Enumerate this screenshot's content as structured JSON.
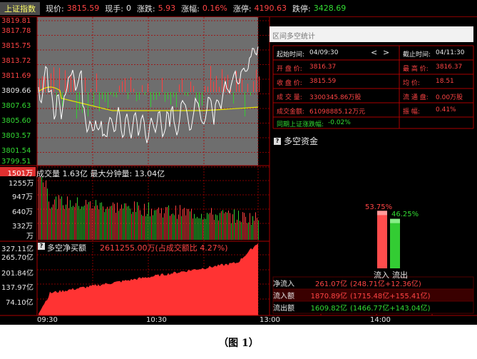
{
  "header": {
    "title": "上证指数",
    "price_label": "现价:",
    "price": "3815.59",
    "vol_label": "现手:",
    "vol": "0",
    "chg_label": "涨跌:",
    "chg": "5.93",
    "pct_label": "涨幅:",
    "pct": "0.16%",
    "high_label": "涨停:",
    "high": "4190.63",
    "low_label": "跌停:",
    "low": "3428.69"
  },
  "price_axis": {
    "labels": [
      "3819.81",
      "3817.78",
      "3815.75",
      "3813.72",
      "3811.69",
      "3809.66",
      "3807.63",
      "3805.60",
      "3803.57",
      "3801.54",
      "3799.51"
    ]
  },
  "volume_section": {
    "current_tag": "1501万",
    "title": "成交量 1.63亿  最大分钟量: 13.04亿",
    "axis_labels": [
      "1255万",
      "947万",
      "640万",
      "332万",
      "万"
    ]
  },
  "net_section": {
    "top_label": "327.11亿",
    "title": "多空净买额",
    "value": "2611255.00万(占成交额比 4.27%)",
    "axis_labels": [
      "265.70亿",
      "201.84亿",
      "137.97亿",
      "74.10亿"
    ]
  },
  "time_axis": {
    "labels": [
      "09:30",
      "10:30",
      "13:00",
      "14:00"
    ]
  },
  "stats_panel": {
    "title": "区间多空统计",
    "start_label": "起始时间:",
    "start": "04/09:30",
    "end_label": "截止时间:",
    "end": "04/11:30",
    "nav_prev": "<",
    "nav_next": ">",
    "open_label": "开  盘  价:",
    "open": "3816.37",
    "high_label": "最  高  价:",
    "high": "3816.37",
    "close_label": "收  盘  价:",
    "close": "3815.59",
    "avg_label": "均        价:",
    "avg": "18.51",
    "volume_label": "成  交  量:",
    "volume": "3300345.86万股",
    "float_label": "流  通  盘:",
    "float": "0.00万股",
    "amount_label": "成交金额:",
    "amount": "61098885.12万元",
    "amp_label": "振        幅:",
    "amp": "0.41%",
    "same_label": "同期上证涨跌幅:",
    "same": "-0.02%"
  },
  "money_flow": {
    "title": "多空资金",
    "inflow_pct": "53.75%",
    "outflow_pct": "46.25%",
    "inflow_ratio": 0.5375,
    "outflow_ratio": 0.4625,
    "inflow_label": "流入",
    "outflow_label": "流出",
    "rows": [
      {
        "label": "净流入",
        "a": "261.07亿",
        "b": "(248.71亿+12.36亿)"
      },
      {
        "label": "流入额",
        "a": "1870.89亿",
        "b": "(1715.48亿+155.41亿)"
      },
      {
        "label": "流出额",
        "a": "1609.82亿",
        "b": "(1466.77亿+143.04亿)"
      }
    ]
  },
  "caption": "（图 1）"
}
